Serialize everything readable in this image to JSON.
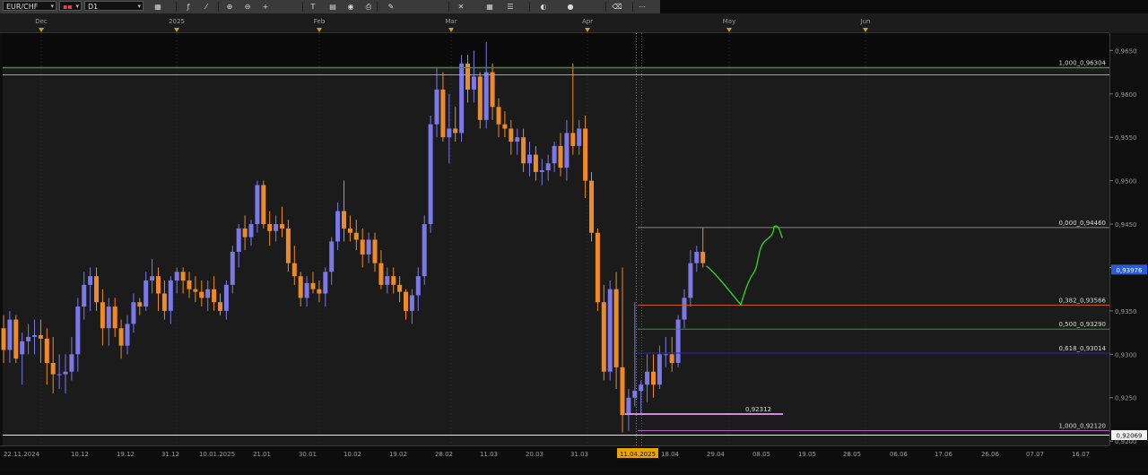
{
  "toolbar": {
    "symbol": "EUR/CHF",
    "chart_style_value": "",
    "timeframe": "D1",
    "icons": [
      "chart-type-icon",
      "indicator-icon",
      "drawing-icon",
      "zoom-in-icon",
      "zoom-out-icon",
      "crosshair-icon",
      "text-tool-icon",
      "template-icon",
      "screenshot-icon",
      "print-icon",
      "pencil-icon",
      "trade-icon",
      "grid-icon",
      "properties-icon",
      "color-icon",
      "sphere-icon",
      "eraser-icon",
      "more-icon"
    ]
  },
  "chart_data": {
    "type": "candlestick",
    "symbol": "EUR/CHF",
    "timeframe": "D1",
    "ylim": [
      0.9195,
      0.967
    ],
    "y_ticks": [
      "0,9650",
      "0,9600",
      "0,9550",
      "0,9500",
      "0,9450",
      "0,9400",
      "0,9350",
      "0,9300",
      "0,9250",
      "0,9200"
    ],
    "top_month_labels": [
      "Dec",
      "2025",
      "Feb",
      "Mar",
      "Apr",
      "May",
      "Jun"
    ],
    "x_date_labels": [
      "22.11.2024",
      "10.12",
      "19.12",
      "31.12",
      "10.01.2025",
      "21.01",
      "30.01",
      "10.02",
      "19.02",
      "28.02",
      "11.03",
      "20.03",
      "31.03",
      "11.04.2025",
      "18.04",
      "29.04",
      "08.05",
      "19.05",
      "28.05",
      "06.06",
      "17.06",
      "26.06",
      "07.07",
      "16.07"
    ],
    "highlighted_x_label": "11.04.2025",
    "current_price": "0,93976",
    "last_price_tag": "0,92069",
    "colors": {
      "bull": "#7b78e8",
      "bear": "#f08a24",
      "background": "#1b1b1b",
      "top_panel": "#0a0a0a",
      "drawn_path": "#2fd020"
    },
    "candles": [
      {
        "o": 0.933,
        "h": 0.9345,
        "l": 0.929,
        "c": 0.9305
      },
      {
        "o": 0.9305,
        "h": 0.935,
        "l": 0.929,
        "c": 0.934
      },
      {
        "o": 0.934,
        "h": 0.9345,
        "l": 0.929,
        "c": 0.9295
      },
      {
        "o": 0.93,
        "h": 0.9325,
        "l": 0.9265,
        "c": 0.9315
      },
      {
        "o": 0.9315,
        "h": 0.9335,
        "l": 0.93,
        "c": 0.932
      },
      {
        "o": 0.932,
        "h": 0.934,
        "l": 0.93,
        "c": 0.9322
      },
      {
        "o": 0.9322,
        "h": 0.934,
        "l": 0.929,
        "c": 0.9318
      },
      {
        "o": 0.9318,
        "h": 0.933,
        "l": 0.9265,
        "c": 0.929
      },
      {
        "o": 0.929,
        "h": 0.932,
        "l": 0.9255,
        "c": 0.9277
      },
      {
        "o": 0.9277,
        "h": 0.93,
        "l": 0.926,
        "c": 0.9277
      },
      {
        "o": 0.9277,
        "h": 0.93,
        "l": 0.9255,
        "c": 0.928
      },
      {
        "o": 0.928,
        "h": 0.932,
        "l": 0.927,
        "c": 0.93
      },
      {
        "o": 0.93,
        "h": 0.9365,
        "l": 0.928,
        "c": 0.9355
      },
      {
        "o": 0.9355,
        "h": 0.9395,
        "l": 0.934,
        "c": 0.938
      },
      {
        "o": 0.938,
        "h": 0.94,
        "l": 0.935,
        "c": 0.939
      },
      {
        "o": 0.939,
        "h": 0.94,
        "l": 0.935,
        "c": 0.936
      },
      {
        "o": 0.936,
        "h": 0.9375,
        "l": 0.931,
        "c": 0.933
      },
      {
        "o": 0.933,
        "h": 0.9365,
        "l": 0.931,
        "c": 0.9355
      },
      {
        "o": 0.9355,
        "h": 0.9365,
        "l": 0.932,
        "c": 0.933
      },
      {
        "o": 0.933,
        "h": 0.934,
        "l": 0.9295,
        "c": 0.931
      },
      {
        "o": 0.931,
        "h": 0.9345,
        "l": 0.93,
        "c": 0.9335
      },
      {
        "o": 0.9335,
        "h": 0.937,
        "l": 0.9325,
        "c": 0.936
      },
      {
        "o": 0.936,
        "h": 0.9365,
        "l": 0.9345,
        "c": 0.9355
      },
      {
        "o": 0.9355,
        "h": 0.9395,
        "l": 0.935,
        "c": 0.9385
      },
      {
        "o": 0.9385,
        "h": 0.941,
        "l": 0.937,
        "c": 0.939
      },
      {
        "o": 0.939,
        "h": 0.94,
        "l": 0.935,
        "c": 0.937
      },
      {
        "o": 0.937,
        "h": 0.9385,
        "l": 0.934,
        "c": 0.935
      },
      {
        "o": 0.935,
        "h": 0.939,
        "l": 0.9335,
        "c": 0.9385
      },
      {
        "o": 0.9385,
        "h": 0.94,
        "l": 0.937,
        "c": 0.9395
      },
      {
        "o": 0.9395,
        "h": 0.94,
        "l": 0.937,
        "c": 0.9385
      },
      {
        "o": 0.9385,
        "h": 0.9395,
        "l": 0.9365,
        "c": 0.9375
      },
      {
        "o": 0.9375,
        "h": 0.939,
        "l": 0.936,
        "c": 0.9372
      },
      {
        "o": 0.9372,
        "h": 0.9385,
        "l": 0.9355,
        "c": 0.9365
      },
      {
        "o": 0.9365,
        "h": 0.9385,
        "l": 0.935,
        "c": 0.9375
      },
      {
        "o": 0.9375,
        "h": 0.939,
        "l": 0.935,
        "c": 0.936
      },
      {
        "o": 0.936,
        "h": 0.937,
        "l": 0.9345,
        "c": 0.935
      },
      {
        "o": 0.935,
        "h": 0.9385,
        "l": 0.934,
        "c": 0.938
      },
      {
        "o": 0.938,
        "h": 0.9425,
        "l": 0.937,
        "c": 0.9418
      },
      {
        "o": 0.9418,
        "h": 0.945,
        "l": 0.94,
        "c": 0.9445
      },
      {
        "o": 0.9445,
        "h": 0.946,
        "l": 0.942,
        "c": 0.9435
      },
      {
        "o": 0.9435,
        "h": 0.9455,
        "l": 0.9425,
        "c": 0.945
      },
      {
        "o": 0.945,
        "h": 0.95,
        "l": 0.944,
        "c": 0.9495
      },
      {
        "o": 0.9495,
        "h": 0.95,
        "l": 0.9445,
        "c": 0.945
      },
      {
        "o": 0.945,
        "h": 0.9465,
        "l": 0.9425,
        "c": 0.9442
      },
      {
        "o": 0.9442,
        "h": 0.946,
        "l": 0.943,
        "c": 0.945
      },
      {
        "o": 0.945,
        "h": 0.947,
        "l": 0.9435,
        "c": 0.9445
      },
      {
        "o": 0.9445,
        "h": 0.9455,
        "l": 0.9395,
        "c": 0.9405
      },
      {
        "o": 0.9405,
        "h": 0.9425,
        "l": 0.938,
        "c": 0.939
      },
      {
        "o": 0.939,
        "h": 0.9395,
        "l": 0.9355,
        "c": 0.9365
      },
      {
        "o": 0.9365,
        "h": 0.939,
        "l": 0.9355,
        "c": 0.9382
      },
      {
        "o": 0.9382,
        "h": 0.9395,
        "l": 0.937,
        "c": 0.9375
      },
      {
        "o": 0.9375,
        "h": 0.9385,
        "l": 0.936,
        "c": 0.937
      },
      {
        "o": 0.937,
        "h": 0.94,
        "l": 0.9355,
        "c": 0.9395
      },
      {
        "o": 0.9395,
        "h": 0.9435,
        "l": 0.938,
        "c": 0.943
      },
      {
        "o": 0.943,
        "h": 0.9475,
        "l": 0.942,
        "c": 0.9465
      },
      {
        "o": 0.9465,
        "h": 0.95,
        "l": 0.943,
        "c": 0.9445
      },
      {
        "o": 0.9445,
        "h": 0.946,
        "l": 0.943,
        "c": 0.944
      },
      {
        "o": 0.944,
        "h": 0.9455,
        "l": 0.942,
        "c": 0.9432
      },
      {
        "o": 0.9432,
        "h": 0.9445,
        "l": 0.94,
        "c": 0.9415
      },
      {
        "o": 0.9415,
        "h": 0.944,
        "l": 0.9405,
        "c": 0.9432
      },
      {
        "o": 0.9432,
        "h": 0.944,
        "l": 0.9395,
        "c": 0.9405
      },
      {
        "o": 0.9405,
        "h": 0.942,
        "l": 0.9375,
        "c": 0.938
      },
      {
        "o": 0.938,
        "h": 0.94,
        "l": 0.937,
        "c": 0.939
      },
      {
        "o": 0.939,
        "h": 0.94,
        "l": 0.937,
        "c": 0.938
      },
      {
        "o": 0.938,
        "h": 0.939,
        "l": 0.936,
        "c": 0.9372
      },
      {
        "o": 0.9372,
        "h": 0.9375,
        "l": 0.934,
        "c": 0.935
      },
      {
        "o": 0.935,
        "h": 0.9375,
        "l": 0.9335,
        "c": 0.9368
      },
      {
        "o": 0.9368,
        "h": 0.94,
        "l": 0.935,
        "c": 0.939
      },
      {
        "o": 0.939,
        "h": 0.946,
        "l": 0.938,
        "c": 0.945
      },
      {
        "o": 0.945,
        "h": 0.9575,
        "l": 0.944,
        "c": 0.9565
      },
      {
        "o": 0.9565,
        "h": 0.963,
        "l": 0.955,
        "c": 0.9605
      },
      {
        "o": 0.9605,
        "h": 0.9625,
        "l": 0.9545,
        "c": 0.955
      },
      {
        "o": 0.955,
        "h": 0.96,
        "l": 0.952,
        "c": 0.956
      },
      {
        "o": 0.956,
        "h": 0.9585,
        "l": 0.9545,
        "c": 0.9555
      },
      {
        "o": 0.9555,
        "h": 0.9645,
        "l": 0.9545,
        "c": 0.9635
      },
      {
        "o": 0.9635,
        "h": 0.9645,
        "l": 0.959,
        "c": 0.9605
      },
      {
        "o": 0.9605,
        "h": 0.965,
        "l": 0.959,
        "c": 0.962
      },
      {
        "o": 0.962,
        "h": 0.9625,
        "l": 0.956,
        "c": 0.957
      },
      {
        "o": 0.957,
        "h": 0.966,
        "l": 0.956,
        "c": 0.9625
      },
      {
        "o": 0.9625,
        "h": 0.9635,
        "l": 0.957,
        "c": 0.9585
      },
      {
        "o": 0.9585,
        "h": 0.9595,
        "l": 0.955,
        "c": 0.9565
      },
      {
        "o": 0.9565,
        "h": 0.958,
        "l": 0.955,
        "c": 0.956
      },
      {
        "o": 0.956,
        "h": 0.957,
        "l": 0.953,
        "c": 0.9545
      },
      {
        "o": 0.9545,
        "h": 0.956,
        "l": 0.953,
        "c": 0.955
      },
      {
        "o": 0.955,
        "h": 0.956,
        "l": 0.951,
        "c": 0.952
      },
      {
        "o": 0.952,
        "h": 0.9545,
        "l": 0.9505,
        "c": 0.953
      },
      {
        "o": 0.953,
        "h": 0.954,
        "l": 0.95,
        "c": 0.951
      },
      {
        "o": 0.951,
        "h": 0.9525,
        "l": 0.9495,
        "c": 0.9512
      },
      {
        "o": 0.9512,
        "h": 0.953,
        "l": 0.95,
        "c": 0.952
      },
      {
        "o": 0.952,
        "h": 0.9545,
        "l": 0.951,
        "c": 0.954
      },
      {
        "o": 0.954,
        "h": 0.9555,
        "l": 0.9505,
        "c": 0.9515
      },
      {
        "o": 0.9515,
        "h": 0.957,
        "l": 0.95,
        "c": 0.9555
      },
      {
        "o": 0.9555,
        "h": 0.9635,
        "l": 0.953,
        "c": 0.954
      },
      {
        "o": 0.954,
        "h": 0.957,
        "l": 0.953,
        "c": 0.956
      },
      {
        "o": 0.956,
        "h": 0.9575,
        "l": 0.948,
        "c": 0.95
      },
      {
        "o": 0.95,
        "h": 0.951,
        "l": 0.943,
        "c": 0.944
      },
      {
        "o": 0.944,
        "h": 0.9445,
        "l": 0.935,
        "c": 0.936
      },
      {
        "o": 0.936,
        "h": 0.938,
        "l": 0.927,
        "c": 0.928
      },
      {
        "o": 0.928,
        "h": 0.9385,
        "l": 0.927,
        "c": 0.9375
      },
      {
        "o": 0.9375,
        "h": 0.9395,
        "l": 0.926,
        "c": 0.9285
      },
      {
        "o": 0.9285,
        "h": 0.94,
        "l": 0.921,
        "c": 0.923
      },
      {
        "o": 0.923,
        "h": 0.926,
        "l": 0.9212,
        "c": 0.925
      },
      {
        "o": 0.925,
        "h": 0.936,
        "l": 0.924,
        "c": 0.9258
      },
      {
        "o": 0.9258,
        "h": 0.927,
        "l": 0.923,
        "c": 0.9265
      },
      {
        "o": 0.9265,
        "h": 0.93,
        "l": 0.9245,
        "c": 0.928
      },
      {
        "o": 0.928,
        "h": 0.93,
        "l": 0.925,
        "c": 0.9265
      },
      {
        "o": 0.9265,
        "h": 0.931,
        "l": 0.926,
        "c": 0.93
      },
      {
        "o": 0.93,
        "h": 0.932,
        "l": 0.9285,
        "c": 0.93
      },
      {
        "o": 0.93,
        "h": 0.932,
        "l": 0.928,
        "c": 0.929
      },
      {
        "o": 0.929,
        "h": 0.9345,
        "l": 0.9285,
        "c": 0.934
      },
      {
        "o": 0.934,
        "h": 0.9375,
        "l": 0.933,
        "c": 0.9365
      },
      {
        "o": 0.9365,
        "h": 0.942,
        "l": 0.9355,
        "c": 0.9405
      },
      {
        "o": 0.9405,
        "h": 0.9425,
        "l": 0.9395,
        "c": 0.9418
      },
      {
        "o": 0.9418,
        "h": 0.9446,
        "l": 0.94,
        "c": 0.9405
      }
    ],
    "horizontal_lines": [
      {
        "name": "resistance-line-green",
        "price": 0.963,
        "color": "#2e9a2e"
      },
      {
        "name": "resistance-line-gold",
        "price": 0.9622,
        "color": "#c8a234"
      },
      {
        "name": "support-line-white",
        "price": 0.92069,
        "color": "#e8e8e8"
      }
    ],
    "fibonacci": {
      "levels": [
        {
          "ratio": "1,000",
          "price": 0.96304,
          "label": "1,000_0,96304",
          "color": "#2e9a2e"
        },
        {
          "ratio": "0,000",
          "price": 0.9446,
          "label": "0,000_0,94460",
          "color": "#8a8a8a"
        },
        {
          "ratio": "0,382",
          "price": 0.93566,
          "label": "0,382_0,93566",
          "color": "#c7591a"
        },
        {
          "ratio": "0,500",
          "price": 0.9329,
          "label": "0,500_0,93290",
          "color": "#2e9a2e"
        },
        {
          "ratio": "0,618",
          "price": 0.93014,
          "label": "0,618_0,93014",
          "color": "#2828b8"
        },
        {
          "ratio": "1,000",
          "price": 0.9212,
          "label": "1,000_0,92120",
          "color": "#b060c0"
        }
      ]
    },
    "annotations": [
      {
        "name": "low-marker",
        "price": 0.92312,
        "label": "0,92312",
        "color": "#d08ae0"
      }
    ]
  }
}
